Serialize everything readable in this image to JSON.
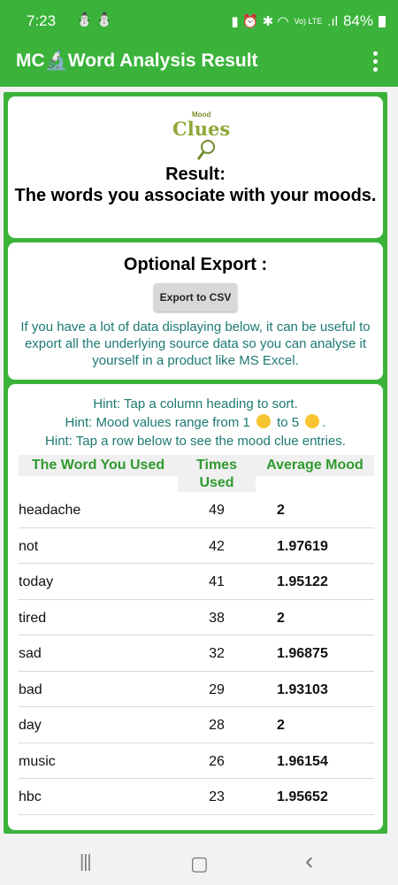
{
  "status": {
    "time": "7:23",
    "left_icons": "⛄⛄",
    "right_icons": "▮ ⏰ ✱ ◠",
    "network": "Vo) LTE",
    "signal": ".ıl",
    "battery": "84%"
  },
  "appbar": {
    "title": "MC🔬Word Analysis Result",
    "menu_icon": "more-vertical-icon"
  },
  "header": {
    "logo_text": "Clues",
    "logo_small": "Mood",
    "result_title": "Result:",
    "result_subtitle": "The words you associate with your moods."
  },
  "export": {
    "title": "Optional Export :",
    "button": "Export to CSV",
    "text": "If you have a lot of data displaying below, it can be useful to export all the underlying source data so you can analyse it yourself in a product like MS Excel."
  },
  "hints": {
    "line1": "Hint: Tap a column heading to sort.",
    "line2a": "Hint: Mood values range from 1",
    "line2b": "to 5",
    "line2c": ".",
    "line3": "Hint: Tap a row below to see the mood clue entries."
  },
  "table": {
    "headers": [
      "The Word You Used",
      "Times Used",
      "Average Mood"
    ],
    "rows": [
      {
        "word": "headache",
        "times": "49",
        "mood": "2"
      },
      {
        "word": "not",
        "times": "42",
        "mood": "1.97619"
      },
      {
        "word": "today",
        "times": "41",
        "mood": "1.95122"
      },
      {
        "word": "tired",
        "times": "38",
        "mood": "2"
      },
      {
        "word": "sad",
        "times": "32",
        "mood": "1.96875"
      },
      {
        "word": "bad",
        "times": "29",
        "mood": "1.93103"
      },
      {
        "word": "day",
        "times": "28",
        "mood": "2"
      },
      {
        "word": "music",
        "times": "26",
        "mood": "1.96154"
      },
      {
        "word": "hbc",
        "times": "23",
        "mood": "1.95652"
      }
    ]
  },
  "nav": {
    "recents": "|||",
    "home": "▢",
    "back": "‹"
  },
  "colors": {
    "brand": "#3bb33b",
    "hint_text": "#1d7a70",
    "header_text": "#2e9a2e"
  }
}
